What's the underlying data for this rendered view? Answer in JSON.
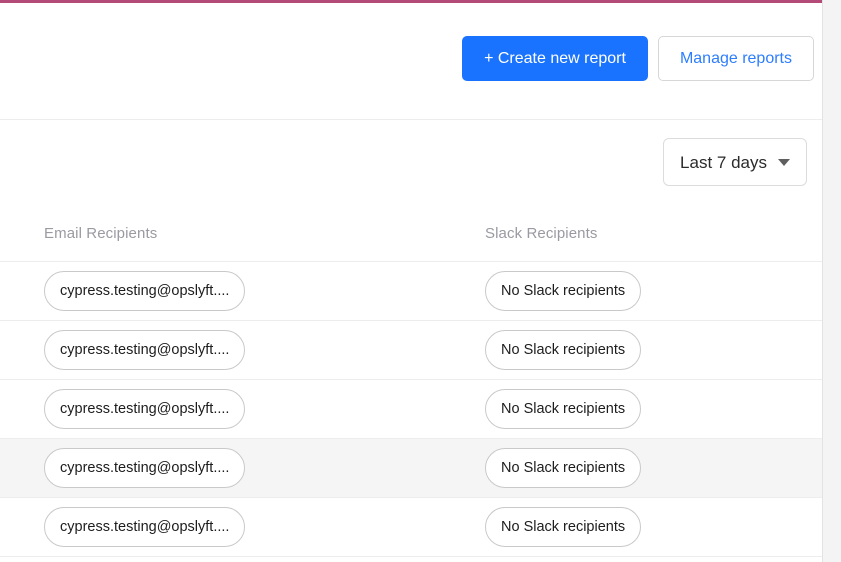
{
  "theme": {
    "accent_bar_color": "#b34a77",
    "primary_button_color": "#1a73ff",
    "link_color": "#2d7dff",
    "row_highlight_color": "#f5f5f5",
    "divider_color": "#ededed"
  },
  "action_bar": {
    "create_report_label": "+ Create new report",
    "manage_reports_label": "Manage reports"
  },
  "filter_bar": {
    "date_range_label": "Last 7 days",
    "date_range_icon": "chevron-down-icon"
  },
  "table": {
    "columns": [
      {
        "key": "email",
        "label": "Email Recipients"
      },
      {
        "key": "slack",
        "label": "Slack Recipients"
      }
    ],
    "rows": [
      {
        "email": "cypress.testing@opslyft....",
        "slack": "No Slack recipients",
        "highlighted": false
      },
      {
        "email": "cypress.testing@opslyft....",
        "slack": "No Slack recipients",
        "highlighted": false
      },
      {
        "email": "cypress.testing@opslyft....",
        "slack": "No Slack recipients",
        "highlighted": false
      },
      {
        "email": "cypress.testing@opslyft....",
        "slack": "No Slack recipients",
        "highlighted": true
      },
      {
        "email": "cypress.testing@opslyft....",
        "slack": "No Slack recipients",
        "highlighted": false
      }
    ]
  }
}
